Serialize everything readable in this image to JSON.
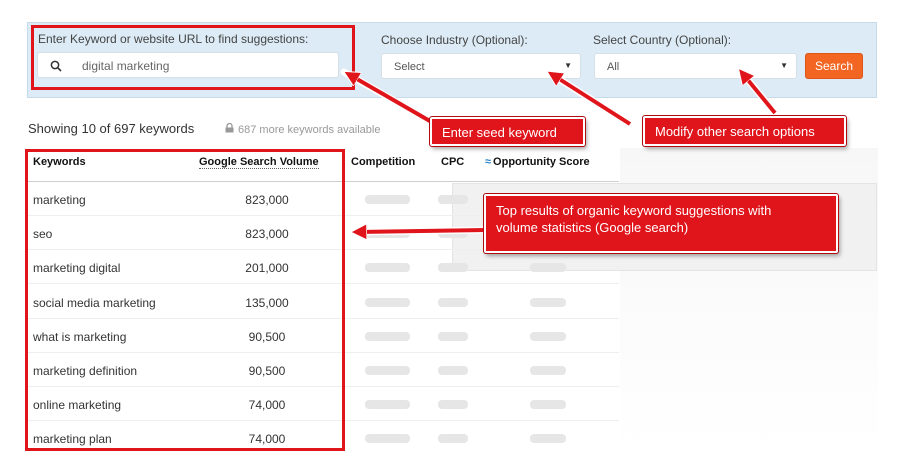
{
  "search_form": {
    "keyword_label": "Enter Keyword or website URL to find suggestions:",
    "keyword_value": "digital  marketing",
    "industry_label": "Choose Industry (Optional):",
    "industry_value": "Select",
    "country_label": "Select Country (Optional):",
    "country_value": "All",
    "search_button": "Search"
  },
  "results_summary": {
    "showing": "Showing 10 of 697 keywords",
    "more": "687 more keywords available"
  },
  "table": {
    "columns": [
      "Keywords",
      "Google Search Volume",
      "Competition",
      "CPC",
      "Opportunity Score"
    ],
    "rows": [
      {
        "keyword": "marketing",
        "volume": "823,000"
      },
      {
        "keyword": "seo",
        "volume": "823,000"
      },
      {
        "keyword": "marketing digital",
        "volume": "201,000"
      },
      {
        "keyword": "social media marketing",
        "volume": "135,000"
      },
      {
        "keyword": "what is marketing",
        "volume": "90,500"
      },
      {
        "keyword": "marketing definition",
        "volume": "90,500"
      },
      {
        "keyword": "online marketing",
        "volume": "74,000"
      },
      {
        "keyword": "marketing plan",
        "volume": "74,000"
      }
    ]
  },
  "annotations": {
    "seed": "Enter seed keyword",
    "options": "Modify other search options",
    "results_line1": "Top results of organic keyword suggestions with",
    "results_line2": "volume statistics (Google search)"
  },
  "colors": {
    "accent_orange": "#f26522",
    "annotation_red": "#e0141b",
    "panel_blue": "#dcebf5"
  },
  "icons": [
    "search-icon",
    "lock-icon",
    "opportunity-wave-icon",
    "caret-down-icon"
  ]
}
